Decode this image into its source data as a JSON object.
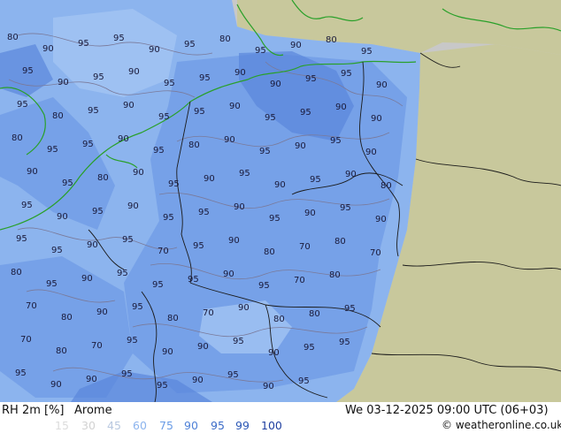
{
  "title": {
    "variable": "RH 2m [%]",
    "model": "Arome",
    "datetime": "We 03-12-2025 09:00 UTC (06+03)",
    "credit": "© weatheronline.co.uk"
  },
  "legend": {
    "items": [
      {
        "label": "15",
        "color": "#dcdcdc"
      },
      {
        "label": "30",
        "color": "#d2d2d2"
      },
      {
        "label": "45",
        "color": "#b8c8e0"
      },
      {
        "label": "60",
        "color": "#8cb4ee"
      },
      {
        "label": "75",
        "color": "#6a9ce6"
      },
      {
        "label": "90",
        "color": "#5082d8"
      },
      {
        "label": "95",
        "color": "#3c6cc8"
      },
      {
        "label": "99",
        "color": "#2c58b6"
      },
      {
        "label": "100",
        "color": "#2040a0"
      }
    ]
  },
  "map": {
    "colors": {
      "land_outside_domain": "#c8c89c",
      "sea_outside_domain": "#c8c8c8",
      "rh_base": "#8cb4ee",
      "rh_high": "#6f9be6",
      "rh_saturated": "#5a86dc",
      "coastline": "#2aa02a",
      "border": "#1a1a1a",
      "contour": "#7a7a9a"
    },
    "contour_labels": [
      {
        "text": "80"
      },
      {
        "text": "90"
      },
      {
        "text": "95"
      },
      {
        "text": "95"
      },
      {
        "text": "90"
      },
      {
        "text": "95"
      },
      {
        "text": "80"
      },
      {
        "text": "95"
      },
      {
        "text": "90"
      },
      {
        "text": "80"
      },
      {
        "text": "95"
      },
      {
        "text": "95"
      },
      {
        "text": "90"
      },
      {
        "text": "95"
      },
      {
        "text": "90"
      },
      {
        "text": "95"
      },
      {
        "text": "95"
      },
      {
        "text": "90"
      },
      {
        "text": "90"
      },
      {
        "text": "95"
      },
      {
        "text": "95"
      },
      {
        "text": "90"
      },
      {
        "text": "95"
      },
      {
        "text": "80"
      },
      {
        "text": "95"
      },
      {
        "text": "90"
      },
      {
        "text": "95"
      },
      {
        "text": "95"
      },
      {
        "text": "90"
      },
      {
        "text": "95"
      },
      {
        "text": "95"
      },
      {
        "text": "90"
      },
      {
        "text": "90"
      },
      {
        "text": "80"
      },
      {
        "text": "95"
      },
      {
        "text": "95"
      },
      {
        "text": "90"
      },
      {
        "text": "95"
      },
      {
        "text": "80"
      },
      {
        "text": "90"
      },
      {
        "text": "95"
      },
      {
        "text": "90"
      },
      {
        "text": "95"
      },
      {
        "text": "90"
      },
      {
        "text": "90"
      },
      {
        "text": "95"
      },
      {
        "text": "80"
      },
      {
        "text": "90"
      },
      {
        "text": "95"
      },
      {
        "text": "90"
      },
      {
        "text": "95"
      },
      {
        "text": "90"
      },
      {
        "text": "95"
      },
      {
        "text": "90"
      },
      {
        "text": "80"
      },
      {
        "text": "95"
      },
      {
        "text": "90"
      },
      {
        "text": "95"
      },
      {
        "text": "90"
      },
      {
        "text": "95"
      },
      {
        "text": "95"
      },
      {
        "text": "90"
      },
      {
        "text": "95"
      },
      {
        "text": "90"
      },
      {
        "text": "95"
      },
      {
        "text": "90"
      },
      {
        "text": "95"
      },
      {
        "text": "95"
      },
      {
        "text": "90"
      },
      {
        "text": "95"
      },
      {
        "text": "70"
      },
      {
        "text": "95"
      },
      {
        "text": "90"
      },
      {
        "text": "80"
      },
      {
        "text": "70"
      },
      {
        "text": "80"
      },
      {
        "text": "70"
      },
      {
        "text": "80"
      },
      {
        "text": "95"
      },
      {
        "text": "90"
      },
      {
        "text": "95"
      },
      {
        "text": "95"
      },
      {
        "text": "95"
      },
      {
        "text": "90"
      },
      {
        "text": "95"
      },
      {
        "text": "70"
      },
      {
        "text": "80"
      },
      {
        "text": "70"
      },
      {
        "text": "80"
      },
      {
        "text": "90"
      },
      {
        "text": "95"
      },
      {
        "text": "80"
      },
      {
        "text": "70"
      },
      {
        "text": "90"
      },
      {
        "text": "80"
      },
      {
        "text": "80"
      },
      {
        "text": "95"
      },
      {
        "text": "70"
      },
      {
        "text": "80"
      },
      {
        "text": "70"
      },
      {
        "text": "95"
      },
      {
        "text": "90"
      },
      {
        "text": "90"
      },
      {
        "text": "95"
      },
      {
        "text": "90"
      },
      {
        "text": "95"
      },
      {
        "text": "95"
      },
      {
        "text": "95"
      },
      {
        "text": "90"
      },
      {
        "text": "90"
      },
      {
        "text": "95"
      },
      {
        "text": "95"
      },
      {
        "text": "90"
      },
      {
        "text": "95"
      },
      {
        "text": "90"
      },
      {
        "text": "95"
      },
      {
        "text": "95"
      },
      {
        "text": "80"
      },
      {
        "text": "95"
      },
      {
        "text": "90"
      }
    ]
  }
}
